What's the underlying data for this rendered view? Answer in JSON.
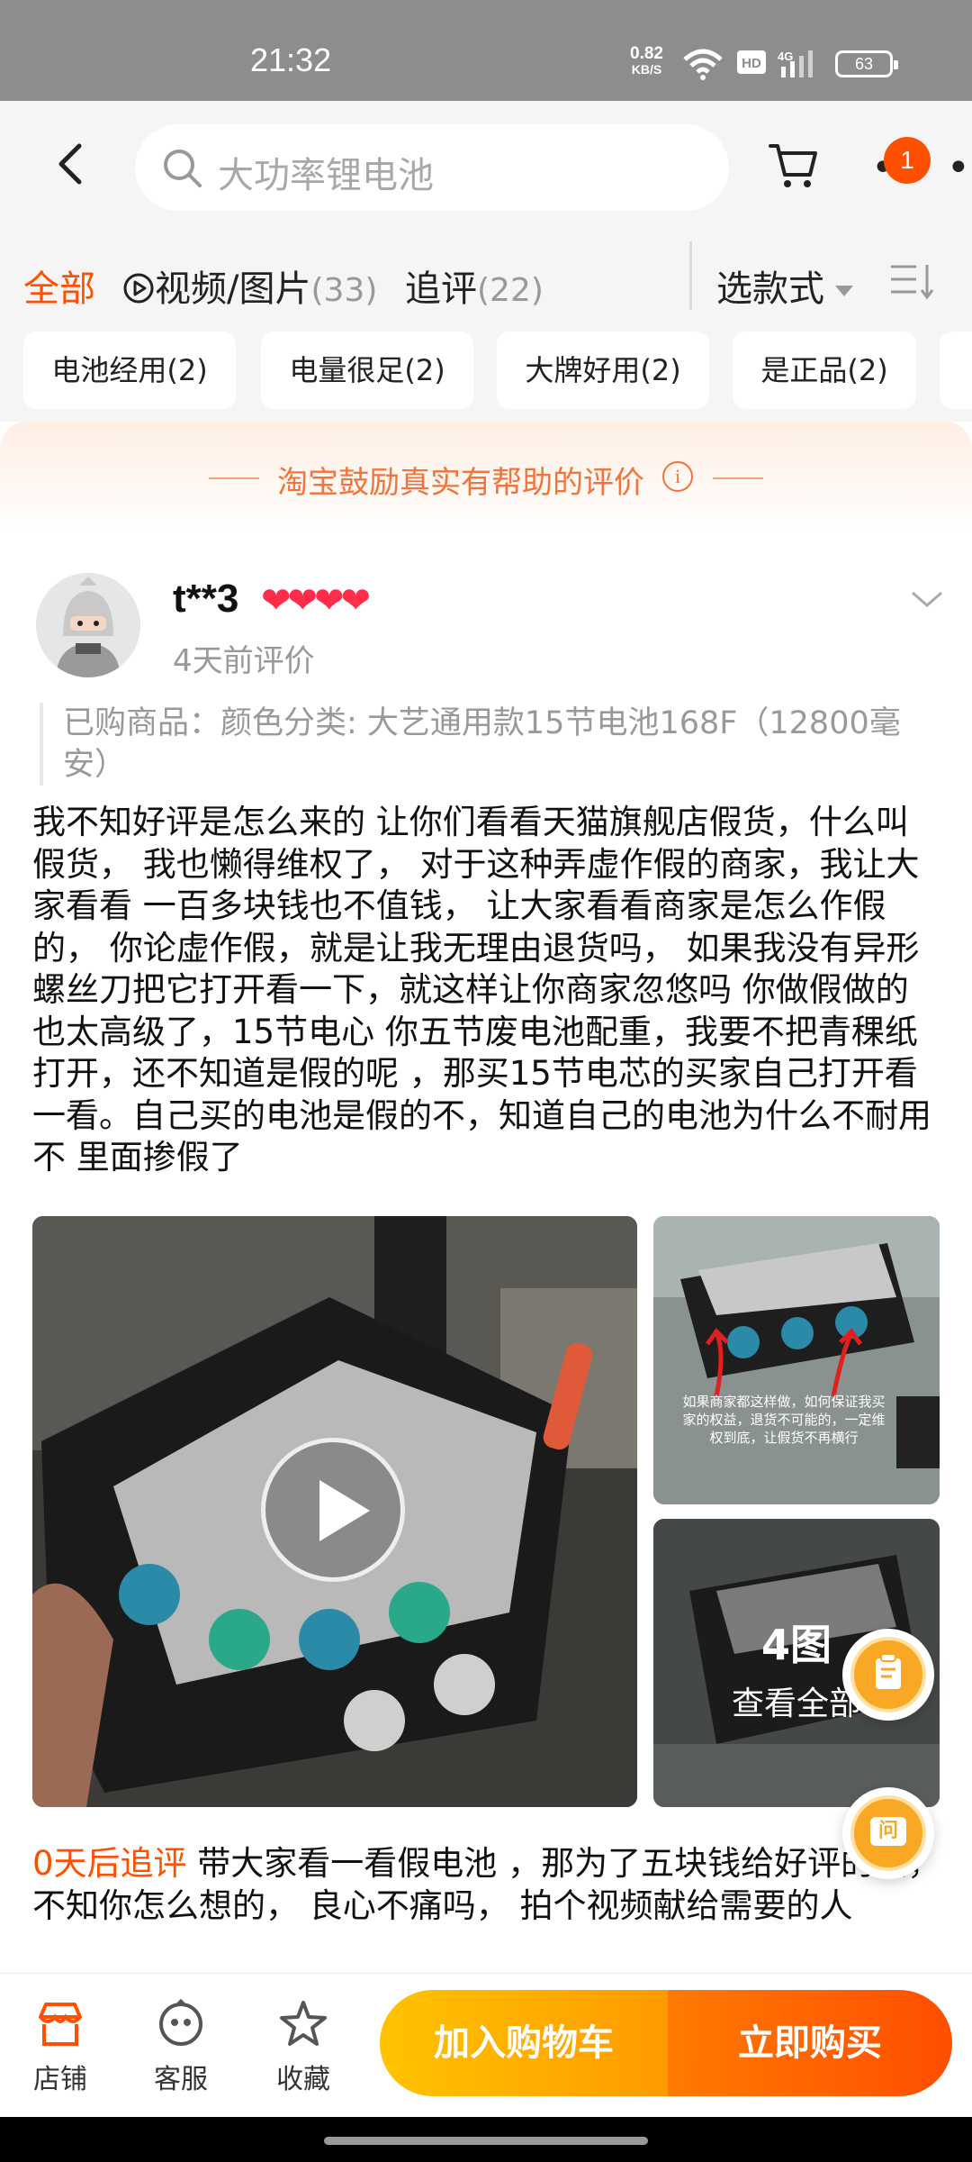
{
  "status_bar": {
    "time": "21:32",
    "net_speed_value": "0.82",
    "net_speed_unit": "KB/S",
    "battery": "63"
  },
  "header": {
    "search_placeholder": "大功率锂电池",
    "cart_badge": "1"
  },
  "filters": {
    "tabs": [
      {
        "label": "全部",
        "count": ""
      },
      {
        "label": "视频/图片",
        "count": "(33)"
      },
      {
        "label": "追评",
        "count": "(22)"
      }
    ],
    "style_select": "选款式"
  },
  "tags": [
    {
      "label": "电池经用",
      "count": "(2)"
    },
    {
      "label": "电量很足",
      "count": "(2)"
    },
    {
      "label": "大牌好用",
      "count": "(2)"
    },
    {
      "label": "是正品",
      "count": "(2)"
    }
  ],
  "banner": {
    "text": "淘宝鼓励真实有帮助的评价",
    "info": "i"
  },
  "review": {
    "username": "t**3",
    "hearts": "❤❤❤❤",
    "time": "4天前评价",
    "purchased": "已购商品：颜色分类: 大艺通用款15节电池168F（12800毫安）",
    "content": "我不知好评是怎么来的 让你们看看天猫旗舰店假货，什么叫假货， 我也懒得维权了， 对于这种弄虚作假的商家，我让大家看看 一百多块钱也不值钱， 让大家看看商家是怎么作假的， 你论虚作假，就是让我无理由退货吗， 如果我没有异形螺丝刀把它打开看一下，就这样让你商家忽悠吗 你做假做的也太高级了，15节电心 你五节废电池配重，我要不把青稞纸打开，还不知道是假的呢 ，那买15节电芯的买家自己打开看一看。自己买的电池是假的不，知道自己的电池为什么不耐用不 里面掺假了",
    "media_count": "4图",
    "media_view_all": "查看全部",
    "image_caption": "如果商家都这样做，如何保证我买家的权益，退货不可能的，一定维权到底，让假货不再横行",
    "followup_tag": "0天后追评",
    "followup_text": " 带大家看一看假电池 ，那为了五块钱给好评的人，不知你怎么想的， 良心不痛吗， 拍个视频献给需要的人"
  },
  "float_buttons": {
    "ask_label": "问"
  },
  "bottom_bar": {
    "store": "店铺",
    "service": "客服",
    "favorite": "收藏",
    "add_cart": "加入购物车",
    "buy_now": "立即购买"
  },
  "colors": {
    "accent": "#ff5000",
    "banner_text": "#f2743b",
    "heart": "#ff2d4a",
    "cart_btn": "#ffb000",
    "buy_btn": "#ff5a00"
  }
}
